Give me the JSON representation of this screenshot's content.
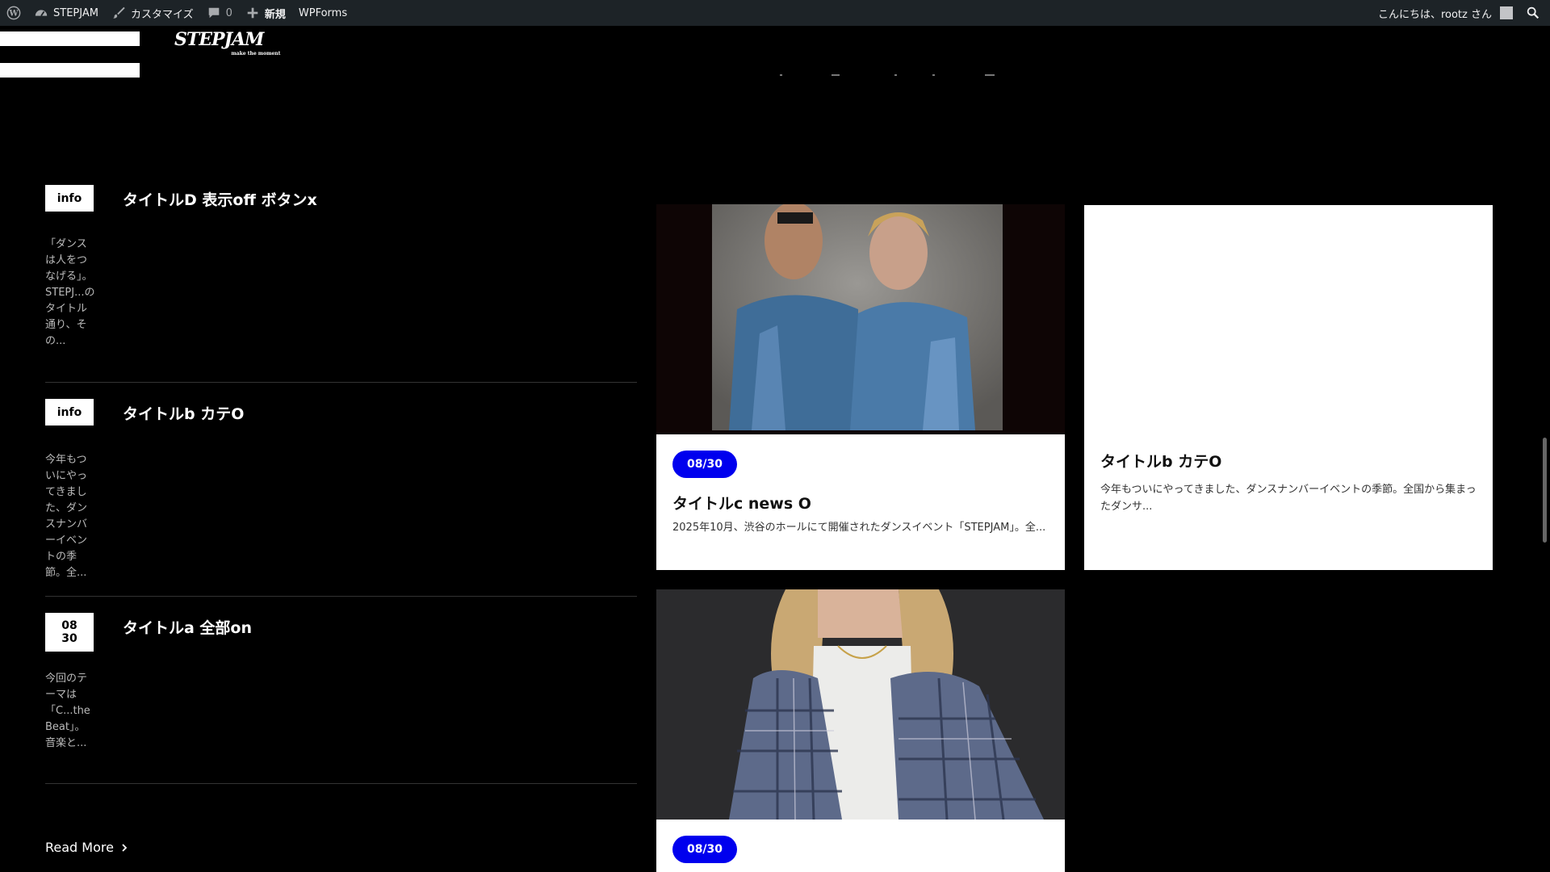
{
  "admin_bar": {
    "site_name": "STEPJAM",
    "customize": "カスタマイズ",
    "comments_count": "0",
    "new_label": "新規",
    "wpforms": "WPForms",
    "greeting": "こんにちは、rootz さん"
  },
  "header": {
    "logo_text": "STEPJAM",
    "logo_sub": "make the moment"
  },
  "news_list": [
    {
      "badge": "info",
      "title": "タイトルD 表示off ボタンx",
      "excerpt": "「ダンスは人をつなげる」。STEPJ...のタイトル通り、その..."
    },
    {
      "badge": "info",
      "title": "タイトルb カテO",
      "excerpt": "今年もついにやってきました、ダンスナンバーイベントの季節。全..."
    },
    {
      "badge_line1": "08",
      "badge_line2": "30",
      "title": "タイトルa 全部on",
      "excerpt": "今回のテーマは「C...the Beat」。音楽と..."
    }
  ],
  "read_more": "Read More",
  "cards": [
    {
      "date": "08/30",
      "title": "タイトルc news O",
      "text": "2025年10月、渋谷のホールにて開催されたダンスイベント「STEPJAM」。全..."
    },
    {
      "title": "タイトルb カテO",
      "text": "今年もついにやってきました、ダンスナンバーイベントの季節。全国から集まったダンサ..."
    },
    {
      "date": "08/30"
    }
  ],
  "colors": {
    "admin_bg": "#1d2327",
    "accent_blue": "#0000ee",
    "page_bg": "#000000"
  }
}
